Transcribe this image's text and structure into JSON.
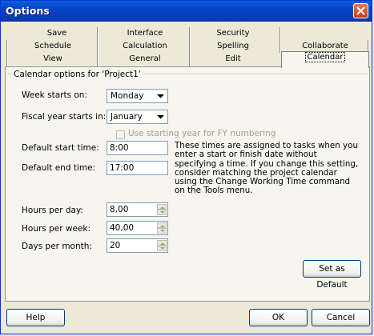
{
  "window": {
    "title": "Options"
  },
  "tabs": {
    "row1": [
      "Save",
      "Interface",
      "Security"
    ],
    "row2": [
      "Schedule",
      "Calculation",
      "Spelling",
      "Collaborate"
    ],
    "row3": [
      "View",
      "General",
      "Edit",
      "Calendar"
    ]
  },
  "calendar": {
    "section_label": "Calendar options for 'Project1'",
    "week_starts_label": "Week starts on:",
    "week_starts_value": "Monday",
    "fiscal_year_label": "Fiscal year starts in:",
    "fiscal_year_value": "January",
    "use_starting_year_label": "Use starting year for FY numbering",
    "default_start_label": "Default start time:",
    "default_start_value": "8:00",
    "default_end_label": "Default end time:",
    "default_end_value": "17:00",
    "note": "These times are assigned to tasks when you enter a start or finish date without specifying a time. If you change this setting, consider matching the project calendar using the Change Working Time command on the Tools menu.",
    "hours_per_day_label": "Hours per day:",
    "hours_per_day_value": "8,00",
    "hours_per_week_label": "Hours per week:",
    "hours_per_week_value": "40,00",
    "days_per_month_label": "Days per month:",
    "days_per_month_value": "20",
    "set_default_label": "Set as Default"
  },
  "footer": {
    "help_label": "Help",
    "ok_label": "OK",
    "cancel_label": "Cancel"
  }
}
